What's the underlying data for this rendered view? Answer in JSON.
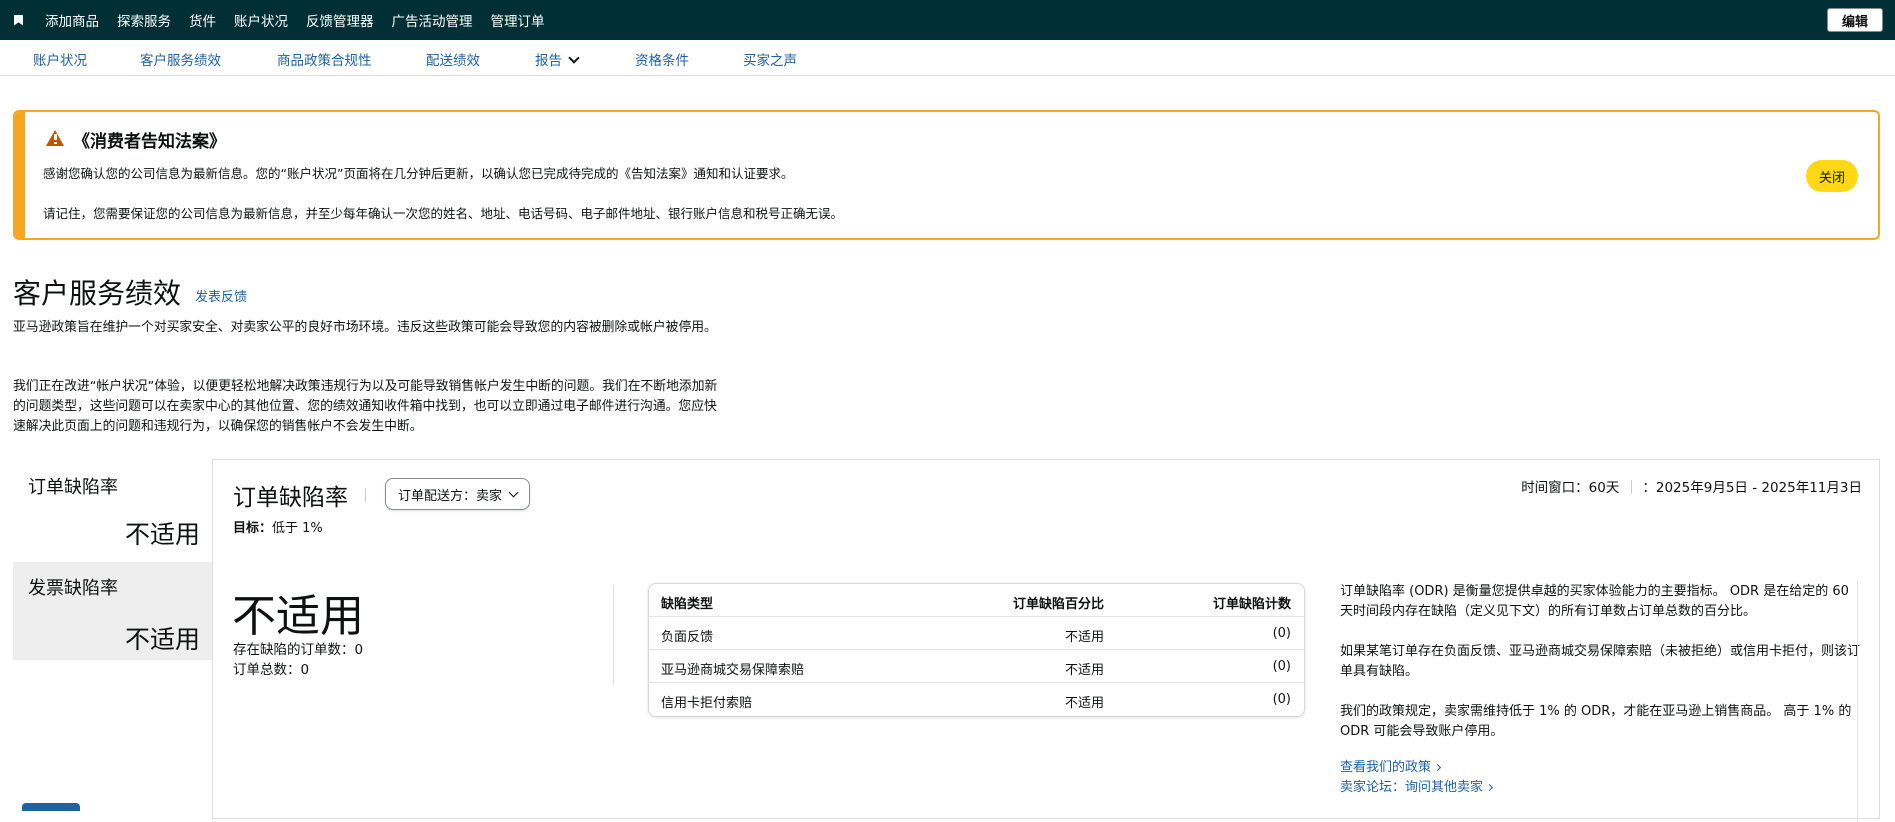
{
  "topnav": {
    "links": [
      "添加商品",
      "探索服务",
      "货件",
      "账户状况",
      "反馈管理器",
      "广告活动管理",
      "管理订单"
    ],
    "edit_label": "编辑"
  },
  "subnav": {
    "links": [
      "账户状况",
      "客户服务绩效",
      "商品政策合规性",
      "配送绩效",
      "报告",
      "资格条件",
      "买家之声"
    ]
  },
  "alert": {
    "title": "《消费者告知法案》",
    "text1": "感谢您确认您的公司信息为最新信息。您的“账户状况”页面将在几分钟后更新，以确认您已完成待完成的《告知法案》通知和认证要求。",
    "text2": "请记住，您需要保证您的公司信息为最新信息，并至少每年确认一次您的姓名、地址、电话号码、电子邮件地址、银行账户信息和税号正确无误。",
    "close_label": "关闭"
  },
  "page": {
    "title": "客户服务绩效",
    "feedback_link": "发表反馈",
    "intro1": "亚马逊政策旨在维护一个对买家安全、对卖家公平的良好市场环境。违反这些政策可能会导致您的内容被删除或帐户被停用。",
    "intro2": "我们正在改进“帐户状况”体验，以便更轻松地解决政策违规行为以及可能导致销售帐户发生中断的问题。我们在不断地添加新的问题类型，这些问题可以在卖家中心的其他位置、您的绩效通知收件箱中找到，也可以立即通过电子邮件进行沟通。您应快速解决此页面上的问题和违规行为，以确保您的销售帐户不会发生中断。"
  },
  "left_tabs": [
    {
      "label": "订单缺陷率",
      "value": "不适用"
    },
    {
      "label": "发票缺陷率",
      "value": "不适用"
    }
  ],
  "card": {
    "title": "订单缺陷率",
    "fulfillment_label": "订单配送方：",
    "fulfillment_value": "卖家",
    "target_label": "目标：",
    "target_value": "低于 1%",
    "time_window": "时间窗口：60天",
    "date_range": "：2025年9月5日 - 2025年11月3日",
    "big_value": "不适用",
    "defective_orders": "存在缺陷的订单数：0",
    "total_orders": "订单总数：0",
    "table": {
      "headers": [
        "缺陷类型",
        "订单缺陷百分比",
        "订单缺陷计数"
      ],
      "rows": [
        [
          "负面反馈",
          "不适用",
          "(0)"
        ],
        [
          "亚马逊商城交易保障索赔",
          "不适用",
          "(0)"
        ],
        [
          "信用卡拒付索赔",
          "不适用",
          "(0)"
        ]
      ]
    },
    "info": [
      "订单缺陷率 (ODR) 是衡量您提供卓越的买家体验能力的主要指标。 ODR 是在给定的 60 天时间段内存在缺陷（定义见下文）的所有订单数占订单总数的百分比。",
      "如果某笔订单存在负面反馈、亚马逊商城交易保障索赔（未被拒绝）或信用卡拒付，则该订单具有缺陷。",
      "我们的政策规定，卖家需维持低于 1% 的 ODR，才能在亚马逊上销售商品。 高于 1% 的 ODR 可能会导致账户停用。"
    ],
    "links": [
      "查看我们的政策",
      "卖家论坛：询问其他卖家"
    ]
  }
}
